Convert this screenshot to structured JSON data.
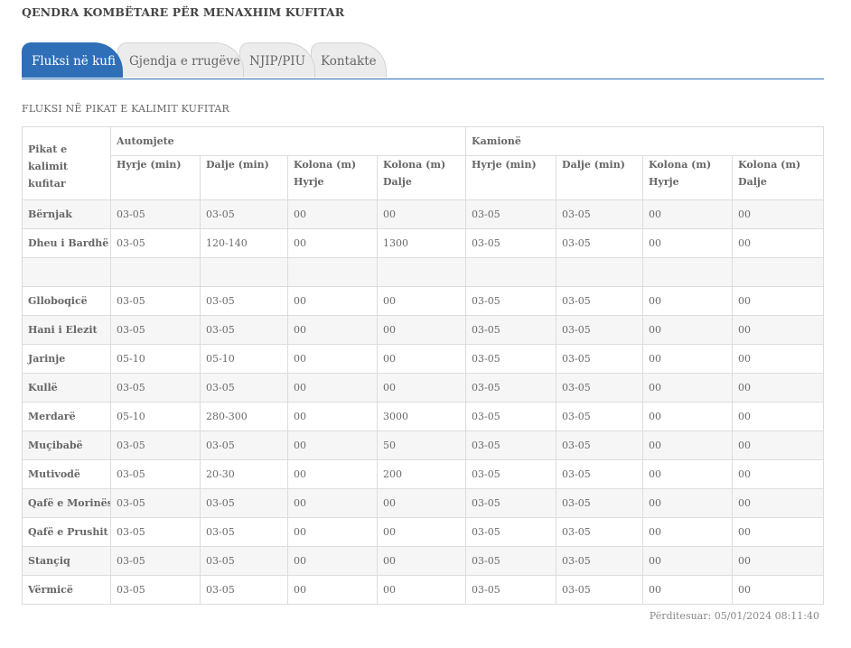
{
  "page": {
    "title": "QENDRA KOMBËTARE PËR MENAXHIM KUFITAR"
  },
  "tabs": [
    {
      "label": "Fluksi në kufi",
      "active": true
    },
    {
      "label": "Gjendja e rrugëve",
      "active": false
    },
    {
      "label": "NJIP/PIU",
      "active": false
    },
    {
      "label": "Kontakte",
      "active": false
    }
  ],
  "section": {
    "title": "FLUKSI NË PIKAT E KALIMIT KUFITAR"
  },
  "table": {
    "row_header": "Pikat e kalimit kufitar",
    "groups": [
      "Automjete",
      "Kamionë"
    ],
    "columns": [
      "Hyrje (min)",
      "Dalje (min)",
      "Kolona (m) Hyrje",
      "Kolona (m) Dalje",
      "Hyrje (min)",
      "Dalje (min)",
      "Kolona (m) Hyrje",
      "Kolona (m) Dalje"
    ],
    "rows": [
      {
        "place": "Bërnjak",
        "values": [
          "03-05",
          "03-05",
          "00",
          "00",
          "03-05",
          "03-05",
          "00",
          "00"
        ]
      },
      {
        "place": "Dheu i Bardhë",
        "values": [
          "03-05",
          "120-140",
          "00",
          "1300",
          "03-05",
          "03-05",
          "00",
          "00"
        ]
      },
      {
        "place": "",
        "values": [
          "",
          "",
          "",
          "",
          "",
          "",
          "",
          ""
        ]
      },
      {
        "place": "Glloboqicë",
        "values": [
          "03-05",
          "03-05",
          "00",
          "00",
          "03-05",
          "03-05",
          "00",
          "00"
        ]
      },
      {
        "place": "Hani i Elezit",
        "values": [
          "03-05",
          "03-05",
          "00",
          "00",
          "03-05",
          "03-05",
          "00",
          "00"
        ]
      },
      {
        "place": "Jarinje",
        "values": [
          "05-10",
          "05-10",
          "00",
          "00",
          "03-05",
          "03-05",
          "00",
          "00"
        ]
      },
      {
        "place": "Kullë",
        "values": [
          "03-05",
          "03-05",
          "00",
          "00",
          "03-05",
          "03-05",
          "00",
          "00"
        ]
      },
      {
        "place": "Merdarë",
        "values": [
          "05-10",
          "280-300",
          "00",
          "3000",
          "03-05",
          "03-05",
          "00",
          "00"
        ]
      },
      {
        "place": "Muçibabë",
        "values": [
          "03-05",
          "03-05",
          "00",
          "50",
          "03-05",
          "03-05",
          "00",
          "00"
        ]
      },
      {
        "place": "Mutivodë",
        "values": [
          "03-05",
          "20-30",
          "00",
          "200",
          "03-05",
          "03-05",
          "00",
          "00"
        ]
      },
      {
        "place": "Qafë e Morinës",
        "values": [
          "03-05",
          "03-05",
          "00",
          "00",
          "03-05",
          "03-05",
          "00",
          "00"
        ]
      },
      {
        "place": "Qafë e Prushit",
        "values": [
          "03-05",
          "03-05",
          "00",
          "00",
          "03-05",
          "03-05",
          "00",
          "00"
        ]
      },
      {
        "place": "Stançiq",
        "values": [
          "03-05",
          "03-05",
          "00",
          "00",
          "03-05",
          "03-05",
          "00",
          "00"
        ]
      },
      {
        "place": "Vërmicë",
        "values": [
          "03-05",
          "03-05",
          "00",
          "00",
          "03-05",
          "03-05",
          "00",
          "00"
        ]
      }
    ]
  },
  "footer": {
    "updated": "Përditesuar: 05/01/2024 08:11:40"
  },
  "colors": {
    "accent": "#2f6fb7",
    "tab_inactive": "#ececec",
    "row_alt": "#f6f6f6",
    "border": "#dcdcdc"
  }
}
